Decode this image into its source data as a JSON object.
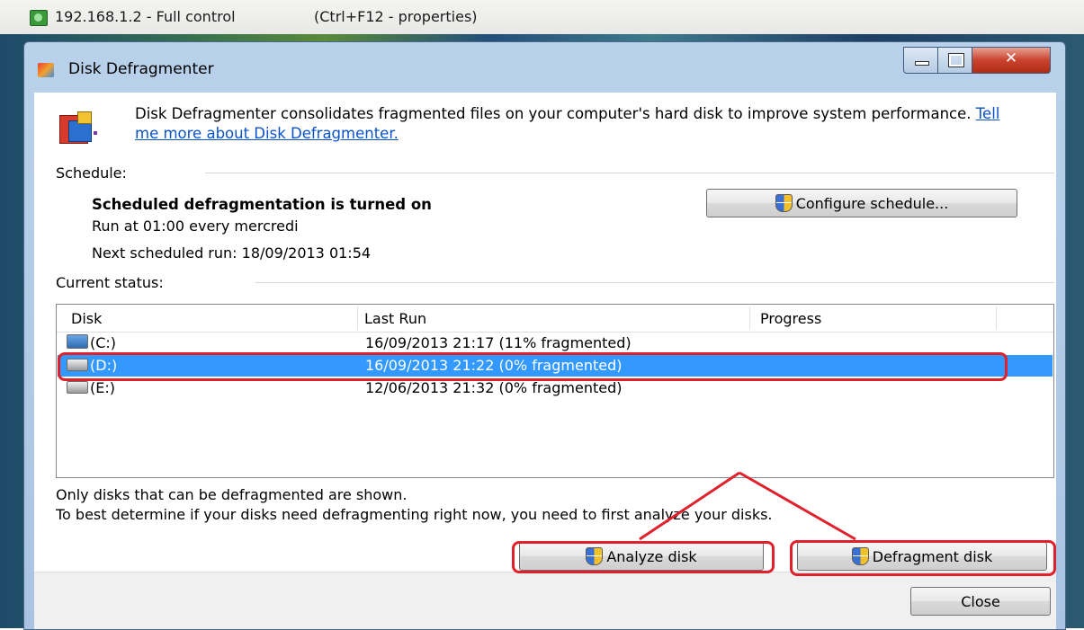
{
  "remote": {
    "title": "192.168.1.2  - Full control",
    "hint": "(Ctrl+F12 - properties)"
  },
  "window": {
    "title": "Disk Defragmenter",
    "close_glyph": "✕"
  },
  "description": {
    "text": "Disk Defragmenter consolidates fragmented files on your computer's hard disk to improve system performance.",
    "link": "Tell me more about Disk Defragmenter."
  },
  "schedule": {
    "label": "Schedule:",
    "status": "Scheduled defragmentation is turned on",
    "run_at": "Run at 01:00 every mercredi",
    "next_run": "Next scheduled run: 18/09/2013 01:54",
    "configure_button": "Configure schedule..."
  },
  "current_status": {
    "label": "Current status:",
    "columns": [
      "Disk",
      "Last Run",
      "Progress"
    ],
    "rows": [
      {
        "disk": "(C:)",
        "last_run": "16/09/2013 21:17 (11% fragmented)",
        "icon": "system-disk-icon",
        "selected": false
      },
      {
        "disk": "(D:)",
        "last_run": "16/09/2013 21:22 (0% fragmented)",
        "icon": "disk-icon",
        "selected": true
      },
      {
        "disk": "(E:)",
        "last_run": "12/06/2013 21:32 (0% fragmented)",
        "icon": "disk-icon",
        "selected": false
      }
    ]
  },
  "notes": {
    "line1": "Only disks that can be defragmented are shown.",
    "line2": "To best determine if your disks need defragmenting right now, you need to first analyze your disks."
  },
  "buttons": {
    "analyze": "Analyze disk",
    "defragment": "Defragment disk",
    "close": "Close"
  },
  "colors": {
    "selection": "#3399ff",
    "annotation": "#e0202a",
    "link": "#0a52c8"
  }
}
